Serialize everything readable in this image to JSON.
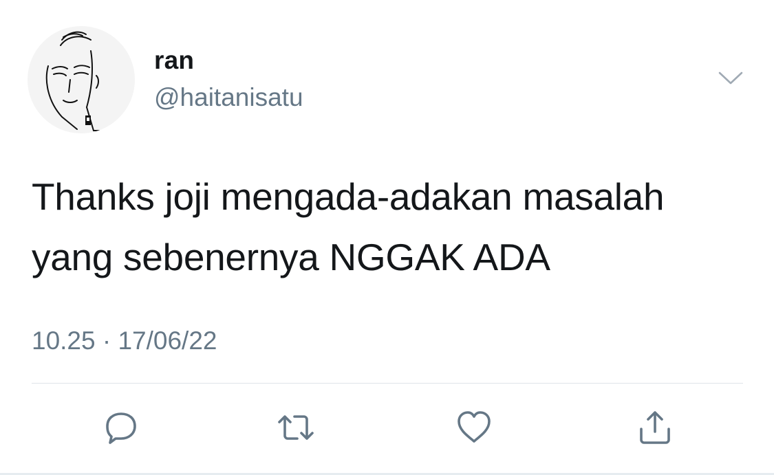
{
  "user": {
    "display_name": "ran",
    "handle": "@haitanisatu",
    "avatar_icon": "avatar-image"
  },
  "tweet": {
    "text": "Thanks joji mengada-adakan masalah yang sebenernya NGGAK ADA",
    "timestamp": "10.25 · 17/06/22"
  },
  "actions": [
    {
      "name": "reply-icon"
    },
    {
      "name": "retweet-icon"
    },
    {
      "name": "like-icon"
    },
    {
      "name": "share-icon"
    }
  ],
  "colors": {
    "text_primary": "#14171a",
    "text_secondary": "#657786",
    "icon": "#657786",
    "divider": "#dfe4e8"
  }
}
